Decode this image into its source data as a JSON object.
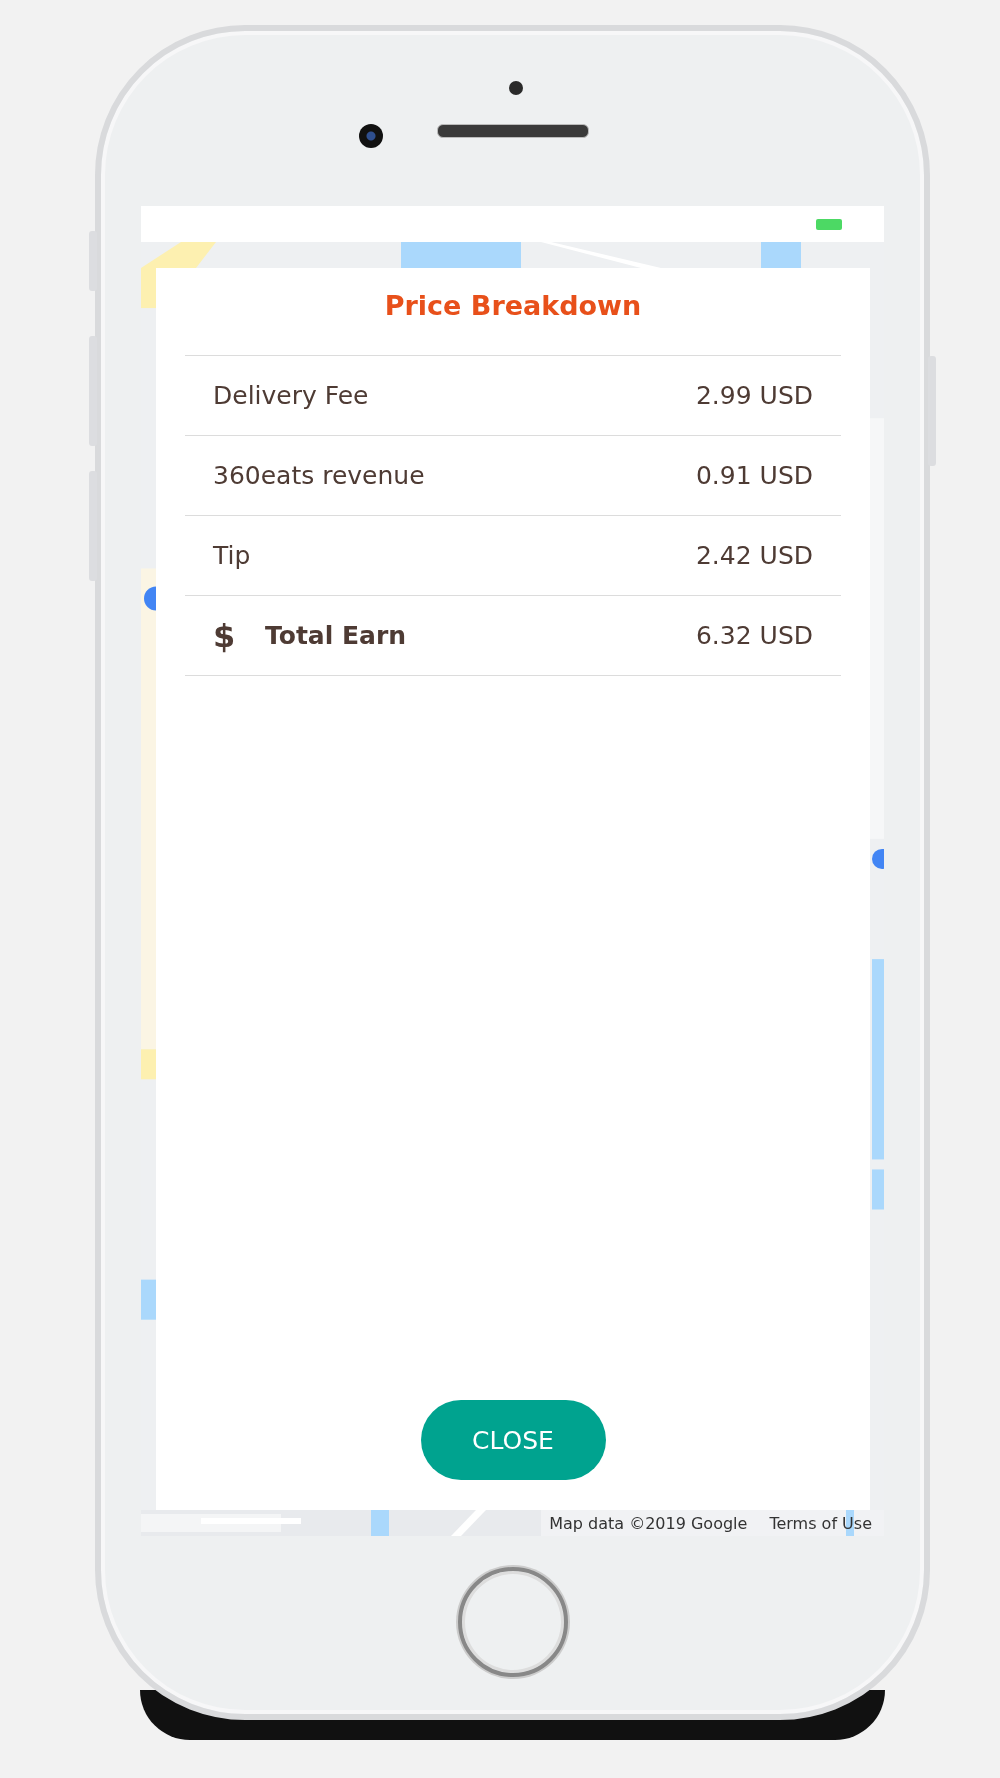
{
  "dialog": {
    "title": "Price Breakdown",
    "rows": [
      {
        "kind": "plain",
        "label": "Delivery Fee",
        "amount": "2.99 USD"
      },
      {
        "kind": "plain",
        "label": "360eats revenue",
        "amount": "0.91 USD"
      },
      {
        "kind": "plain",
        "label": "Tip",
        "amount": "2.42 USD"
      },
      {
        "kind": "total",
        "icon": "$",
        "label": "Total Earn",
        "amount": "6.32 USD"
      }
    ],
    "button": "CLOSE"
  },
  "map": {
    "kind": "picture",
    "attribution": "Map data ©2019 Google",
    "terms_link": "Terms of Use"
  }
}
